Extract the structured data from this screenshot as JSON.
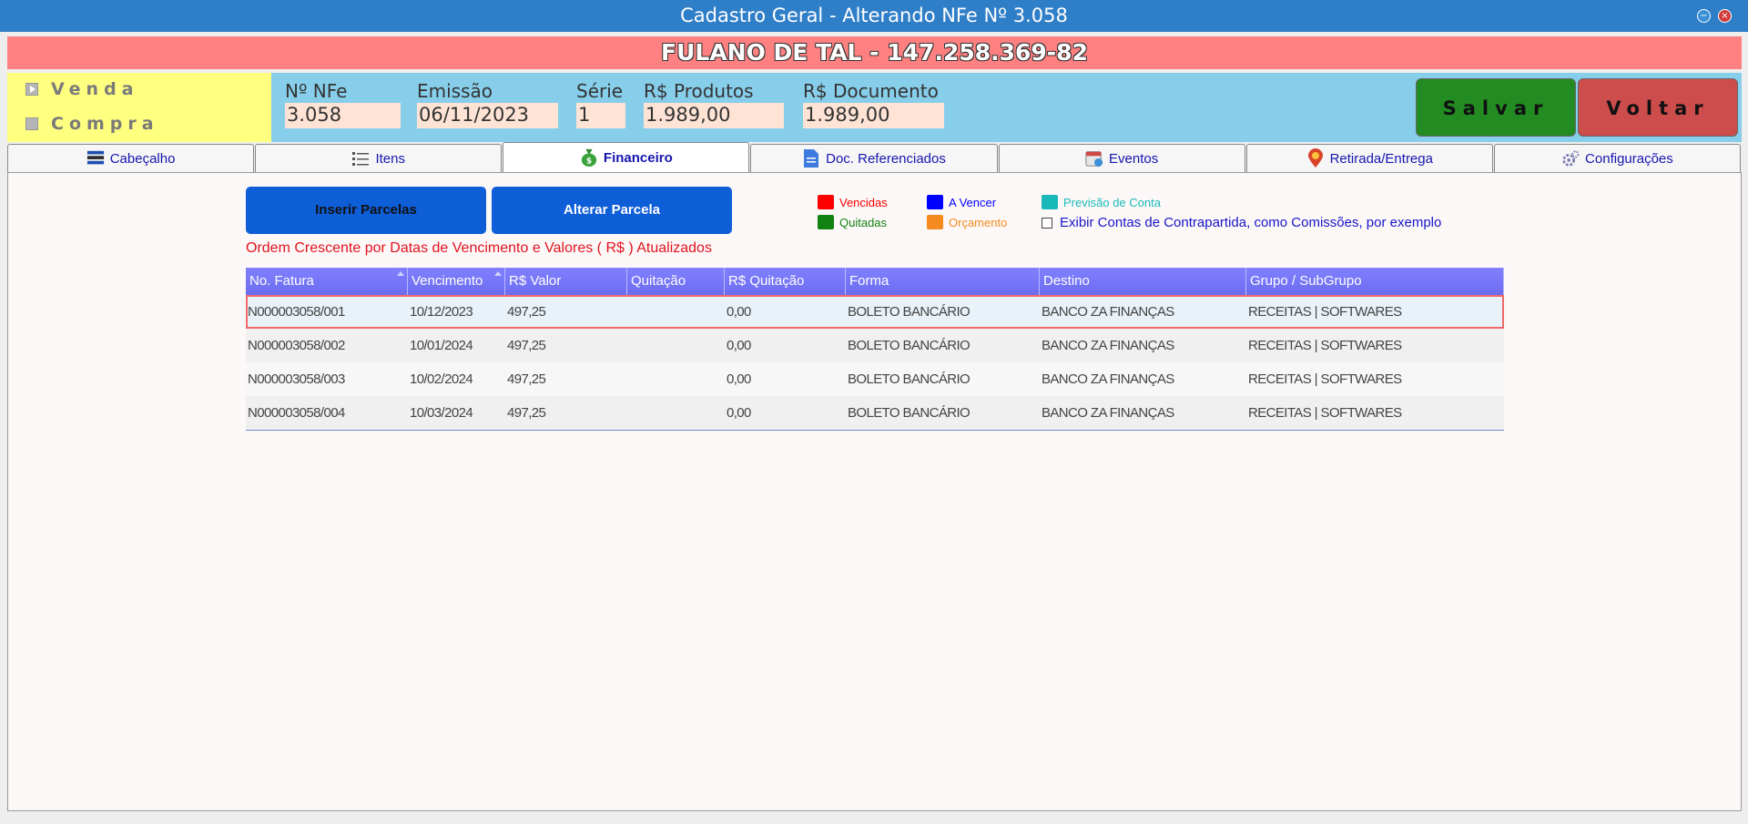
{
  "window": {
    "title": "Cadastro Geral - Alterando NFe Nº 3.058",
    "minimize_icon": "−",
    "close_icon": "×"
  },
  "client": {
    "name_line": "FULANO DE TAL - 147.258.369-82"
  },
  "operation": {
    "options": [
      {
        "label": "Venda",
        "selected": true
      },
      {
        "label": "Compra",
        "selected": false
      }
    ]
  },
  "nfe": {
    "numero_label": "Nº NFe",
    "numero": "3.058",
    "emissao_label": "Emissão",
    "emissao": "06/11/2023",
    "serie_label": "Série",
    "serie": "1",
    "produtos_label": "R$ Produtos",
    "produtos": "1.989,00",
    "documento_label": "R$ Documento",
    "documento": "1.989,00"
  },
  "actions": {
    "save_label": "Salvar",
    "back_label": "Voltar"
  },
  "tabs": [
    {
      "label": "Cabeçalho",
      "icon": "list-header-icon",
      "active": false
    },
    {
      "label": "Itens",
      "icon": "list-icon",
      "active": false
    },
    {
      "label": "Financeiro",
      "icon": "money-bag-icon",
      "active": true
    },
    {
      "label": "Doc. Referenciados",
      "icon": "document-icon",
      "active": false
    },
    {
      "label": "Eventos",
      "icon": "calendar-icon",
      "active": false
    },
    {
      "label": "Retirada/Entrega",
      "icon": "location-pin-icon",
      "active": false
    },
    {
      "label": "Configurações",
      "icon": "gears-icon",
      "active": false
    }
  ],
  "financeiro": {
    "insert_label": "Inserir Parcelas",
    "edit_label": "Alterar Parcela",
    "legend": {
      "vencidas": {
        "label": "Vencidas",
        "color": "#ff0000"
      },
      "a_vencer": {
        "label": "A Vencer",
        "color": "#0000ff"
      },
      "previsao": {
        "label": "Previsão de Conta",
        "color": "#19b9b9"
      },
      "quitadas": {
        "label": "Quitadas",
        "color": "#128212"
      },
      "orcamento": {
        "label": "Orçamento",
        "color": "#f58a1f"
      },
      "contrapartida": {
        "label": "Exibir Contas de Contrapartida, como Comissões, por exemplo",
        "checked": false
      }
    },
    "order_note": "Ordem Crescente por Datas de Vencimento e Valores ( R$ ) Atualizados",
    "columns": [
      "No. Fatura",
      "Vencimento",
      "R$ Valor",
      "Quitação",
      "R$ Quitação",
      "Forma",
      "Destino",
      "Grupo / SubGrupo"
    ],
    "rows": [
      [
        "N000003058/001",
        "10/12/2023",
        "497,25",
        "",
        "0,00",
        "BOLETO BANCÁRIO",
        "BANCO ZA FINANÇAS",
        "RECEITAS | SOFTWARES"
      ],
      [
        "N000003058/002",
        "10/01/2024",
        "497,25",
        "",
        "0,00",
        "BOLETO BANCÁRIO",
        "BANCO ZA FINANÇAS",
        "RECEITAS | SOFTWARES"
      ],
      [
        "N000003058/003",
        "10/02/2024",
        "497,25",
        "",
        "0,00",
        "BOLETO BANCÁRIO",
        "BANCO ZA FINANÇAS",
        "RECEITAS | SOFTWARES"
      ],
      [
        "N000003058/004",
        "10/03/2024",
        "497,25",
        "",
        "0,00",
        "BOLETO BANCÁRIO",
        "BANCO ZA FINANÇAS",
        "RECEITAS | SOFTWARES"
      ]
    ]
  }
}
